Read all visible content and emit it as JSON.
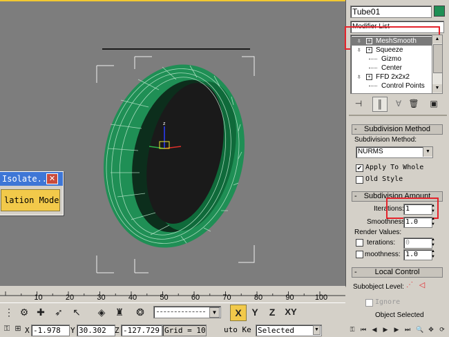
{
  "viewport": {
    "dialog": {
      "title": "Isolate...",
      "button_label": "lation Mode",
      "close_glyph": "✕"
    }
  },
  "panel": {
    "object_name": "Tube01",
    "modifier_list_label": "Modifier List",
    "modifier_stack": [
      {
        "label": "MeshSmooth",
        "selected": true
      },
      {
        "label": "Squeeze"
      },
      {
        "label": "Gizmo",
        "sub": true
      },
      {
        "label": "Center",
        "sub": true
      },
      {
        "label": "FFD 2x2x2"
      },
      {
        "label": "Control Points",
        "sub": true
      }
    ],
    "subdivision_method": {
      "header": "Subdivision Method",
      "method_label": "Subdivision Method:",
      "method_value": "NURMS",
      "apply_to_whole_label": "Apply To Whole",
      "apply_to_whole": true,
      "old_style_label": "Old Style",
      "old_style": false
    },
    "subdivision_amount": {
      "header": "Subdivision Amount",
      "iterations_label": "Iterations:",
      "iterations_value": "1",
      "smoothness_label": "Smoothness:",
      "smoothness_value": "1.0",
      "render_values_label": "Render Values:",
      "render_iterations_label": "terations:",
      "render_iterations_value": "0",
      "render_smoothness_label": "moothness:",
      "render_smoothness_value": "1.0"
    },
    "local_control": {
      "header": "Local Control",
      "subobject_label": "Subobject Level:",
      "ignore_label": "Ignore",
      "object_selected": "Object Selected"
    }
  },
  "ruler": {
    "ticks": [
      "10",
      "20",
      "30",
      "40",
      "50",
      "60",
      "70",
      "80",
      "90",
      "100"
    ]
  },
  "toolbar": {
    "axis_x": "X",
    "axis_y": "Y",
    "axis_z": "Z",
    "axis_xy": "XY"
  },
  "status": {
    "x_label": "X:",
    "x_value": "-1.978",
    "y_label": "Y:",
    "y_value": "30.302",
    "z_label": "Z:",
    "z_value": "-127.729",
    "grid": "Grid = 10.",
    "auto_key": "uto Ke",
    "selected": "Selected"
  },
  "colors": {
    "viewport_bg": "#7d7d7d",
    "tube_green": "#1f8f55",
    "selection_red": "#e4222a",
    "isolate_yellow": "#f2c94a",
    "axis_yellow": "#f2c830"
  }
}
